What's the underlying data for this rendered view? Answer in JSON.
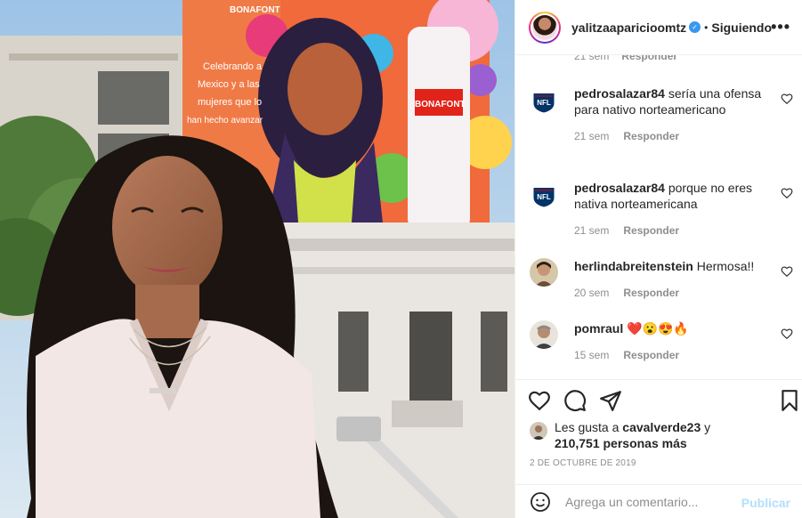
{
  "header": {
    "username": "yalitzaaparicioomtz",
    "separator": "•",
    "follow_label": "Siguiendo",
    "more_label": "•••"
  },
  "clipped_comment": {
    "time": "21 sem",
    "reply": "Responder"
  },
  "comments": [
    {
      "user": "pedrosalazar84",
      "text": "sería una ofensa para nativo norteamericano",
      "time": "21 sem",
      "reply": "Responder",
      "avatar": "nfl-logo"
    },
    {
      "user": "pedrosalazar84",
      "text": "porque no eres nativa norteamericana",
      "time": "21 sem",
      "reply": "Responder",
      "avatar": "nfl-logo"
    },
    {
      "user": "herlindabreitenstein",
      "text": "Hermosa!!",
      "time": "20 sem",
      "reply": "Responder",
      "avatar": "person-photo"
    },
    {
      "user": "pomraul",
      "text": "❤️😮😍🔥",
      "time": "15 sem",
      "reply": "Responder",
      "avatar": "person-photo"
    }
  ],
  "likes": {
    "prefix": "Les gusta a",
    "user": "cavalverde23",
    "conj": "y",
    "count": "210,751 personas más"
  },
  "post_date": "2 DE OCTUBRE DE 2019",
  "add_comment": {
    "placeholder": "Agrega un comentario...",
    "publish_label": "Publicar"
  },
  "photo_texts": {
    "brand": "BONAFONT",
    "mural_line1": "Celebrando a",
    "mural_line2": "Mexico y a las",
    "mural_line3": "mujeres que lo",
    "mural_line4": "han hecho avanzar"
  },
  "colors": {
    "accent_blue": "#3897f0",
    "publish_disabled": "#b2dffc",
    "meta_gray": "#8e8e8e",
    "heart_red": "#ed4956"
  }
}
